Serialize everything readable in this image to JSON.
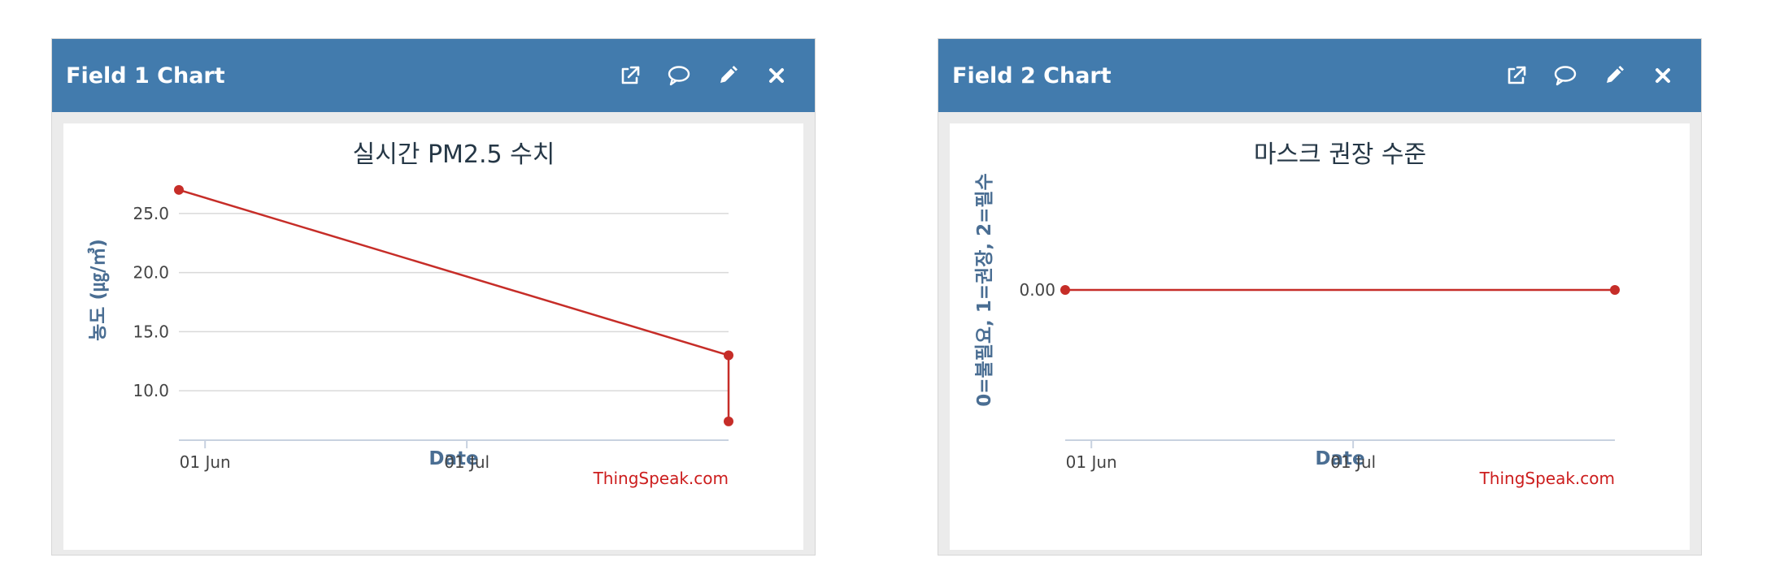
{
  "colors": {
    "header": "#427bad",
    "series": "#c62d28",
    "grid": "#d9d9d9",
    "axis_title": "#4a6e93",
    "credit": "#cc1d1d"
  },
  "icons": [
    "external-link-icon",
    "comment-icon",
    "pencil-icon",
    "close-icon"
  ],
  "widgets": [
    {
      "title": "Field 1 Chart",
      "chart_data": {
        "type": "line",
        "title": "실시간 PM2.5 수치",
        "xlabel": "Date",
        "ylabel": "농도 (㎍/㎥)",
        "credit": "ThingSpeak.com",
        "x_ticks": [
          "01 Jun",
          "01 Jul"
        ],
        "y_ticks": [
          "10.0",
          "15.0",
          "20.0",
          "25.0"
        ],
        "series": [
          {
            "x": [
              "2023-05-29",
              "2023-07-31",
              "2023-07-31"
            ],
            "values": [
              27.0,
              13.0,
              7.4
            ]
          }
        ],
        "ylim": [
          6.5,
          28.5
        ],
        "grid": true
      }
    },
    {
      "title": "Field 2 Chart",
      "chart_data": {
        "type": "line",
        "title": "마스크 권장 수준",
        "xlabel": "Date",
        "ylabel": "0=불필요, 1=권장, 2=필수",
        "credit": "ThingSpeak.com",
        "x_ticks": [
          "01 Jun",
          "01 Jul"
        ],
        "y_ticks": [
          "0.00"
        ],
        "series": [
          {
            "x": [
              "2023-05-29",
              "2023-07-31"
            ],
            "values": [
              0,
              0
            ]
          }
        ],
        "grid": false
      }
    }
  ]
}
